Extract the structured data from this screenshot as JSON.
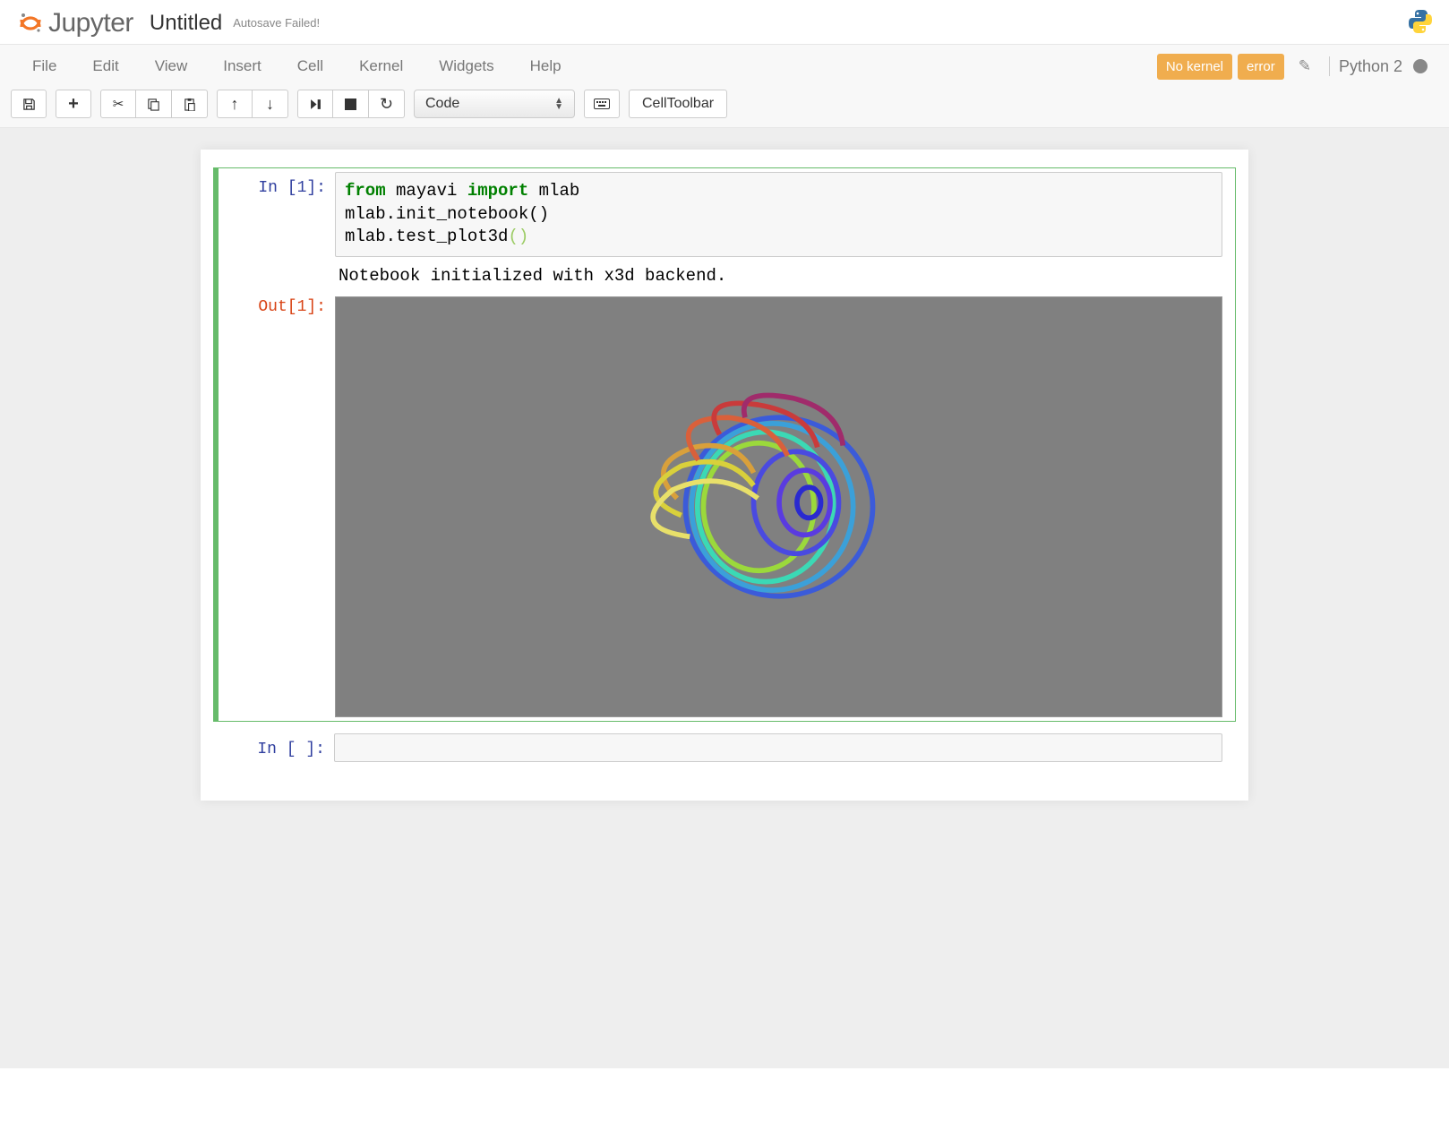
{
  "header": {
    "app_name": "Jupyter",
    "doc_title": "Untitled",
    "autosave_status": "Autosave Failed!"
  },
  "menubar": {
    "items": [
      "File",
      "Edit",
      "View",
      "Insert",
      "Cell",
      "Kernel",
      "Widgets",
      "Help"
    ],
    "badges": [
      "No kernel",
      "error"
    ],
    "kernel_name": "Python 2"
  },
  "toolbar": {
    "icons": {
      "save": "save-icon",
      "add": "add-icon",
      "cut": "cut-icon",
      "copy": "copy-icon",
      "paste": "paste-icon",
      "up": "arrow-up-icon",
      "down": "arrow-down-icon",
      "run": "step-forward-icon",
      "stop": "stop-icon",
      "restart": "refresh-icon",
      "keyboard": "keyboard-icon"
    },
    "cell_type": "Code",
    "cell_toolbar_label": "CellToolbar"
  },
  "cells": [
    {
      "prompt_in": "In [1]:",
      "code_parts": {
        "l1_kw1": "from",
        "l1_mod": " mayavi ",
        "l1_kw2": "import",
        "l1_name": " mlab",
        "l2": "mlab.init_notebook()",
        "l3_pre": "mlab.test_plot3d",
        "l3_paren": "()"
      },
      "text_output": "Notebook initialized with x3d backend.",
      "prompt_out": "Out[1]:"
    },
    {
      "prompt_in": "In [ ]:"
    }
  ]
}
